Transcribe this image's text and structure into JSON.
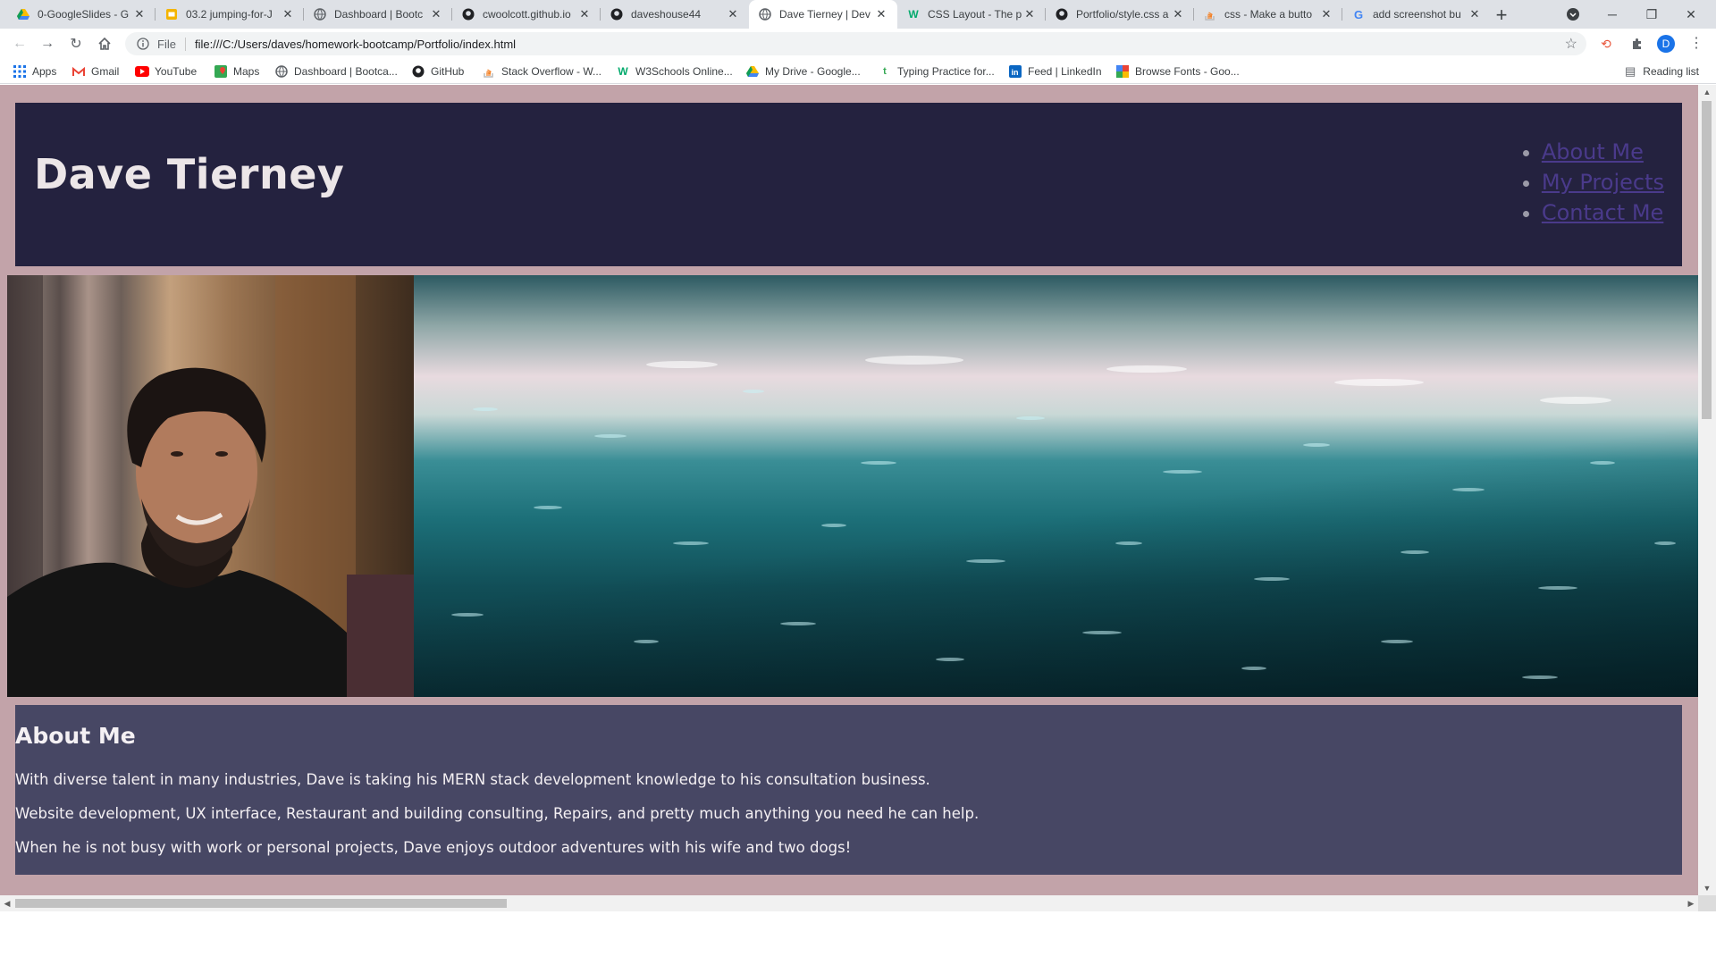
{
  "browser": {
    "tabs": [
      {
        "title": "0-GoogleSlides - G",
        "icon": "google-drive-icon",
        "color": "#fbbc04",
        "active": false
      },
      {
        "title": "03.2 jumping-for-J",
        "icon": "slides-icon",
        "color": "#f4b400",
        "active": false
      },
      {
        "title": "Dashboard | Bootc",
        "icon": "globe-icon",
        "color": "#5f6368",
        "active": false
      },
      {
        "title": "cwoolcott.github.io",
        "icon": "github-icon",
        "color": "#202124",
        "active": false
      },
      {
        "title": "daveshouse44",
        "icon": "github-icon",
        "color": "#202124",
        "active": false
      },
      {
        "title": "Dave Tierney | Dev",
        "icon": "globe-icon",
        "color": "#5f6368",
        "active": true
      },
      {
        "title": "CSS Layout - The p",
        "icon": "w3schools-icon",
        "color": "#04aa6d",
        "active": false
      },
      {
        "title": "Portfolio/style.css a",
        "icon": "github-icon",
        "color": "#202124",
        "active": false
      },
      {
        "title": "css - Make a butto",
        "icon": "stackoverflow-icon",
        "color": "#f48024",
        "active": false
      },
      {
        "title": "add screenshot bu",
        "icon": "google-icon",
        "color": "#4285f4",
        "active": false
      }
    ],
    "address": {
      "scheme_label": "File",
      "url": "file:///C:/Users/daves/homework-bootcamp/Portfolio/index.html"
    },
    "profile_initial": "D",
    "bookmarks": [
      {
        "label": "Apps",
        "icon": "apps-grid-icon",
        "color": "#1a73e8"
      },
      {
        "label": "Gmail",
        "icon": "gmail-icon",
        "color": "#ea4335"
      },
      {
        "label": "YouTube",
        "icon": "youtube-icon",
        "color": "#ff0000"
      },
      {
        "label": "Maps",
        "icon": "maps-icon",
        "color": "#34a853"
      },
      {
        "label": "Dashboard | Bootca...",
        "icon": "globe-icon",
        "color": "#5f6368"
      },
      {
        "label": "GitHub",
        "icon": "github-icon",
        "color": "#202124"
      },
      {
        "label": "Stack Overflow - W...",
        "icon": "stackoverflow-icon",
        "color": "#f48024"
      },
      {
        "label": "W3Schools Online...",
        "icon": "w3schools-icon",
        "color": "#04aa6d"
      },
      {
        "label": "My Drive - Google...",
        "icon": "google-drive-icon",
        "color": "#fbbc04"
      },
      {
        "label": "Typing Practice for...",
        "icon": "typing-icon",
        "color": "#34a853"
      },
      {
        "label": "Feed | LinkedIn",
        "icon": "linkedin-icon",
        "color": "#0a66c2"
      },
      {
        "label": "Browse Fonts - Goo...",
        "icon": "google-fonts-icon",
        "color": "#4285f4"
      }
    ],
    "reading_list": "Reading list"
  },
  "page": {
    "title": "Dave Tierney",
    "nav": [
      "About Me",
      "My Projects",
      "Contact Me"
    ],
    "about": {
      "heading": "About Me",
      "paragraphs": [
        "With diverse talent in many industries, Dave is taking his MERN stack development knowledge to his consultation business.",
        "Website development, UX interface, Restaurant and building consulting, Repairs, and pretty much anything you need he can help.",
        "When he is not busy with work or personal projects, Dave enjoys outdoor adventures with his wife and two dogs!"
      ]
    }
  },
  "colors": {
    "page_background": "#c2a3a9",
    "header_background": "#24223f",
    "about_background": "#474764",
    "nav_link": "#4a3a8b",
    "title_text": "#ece6e8"
  }
}
